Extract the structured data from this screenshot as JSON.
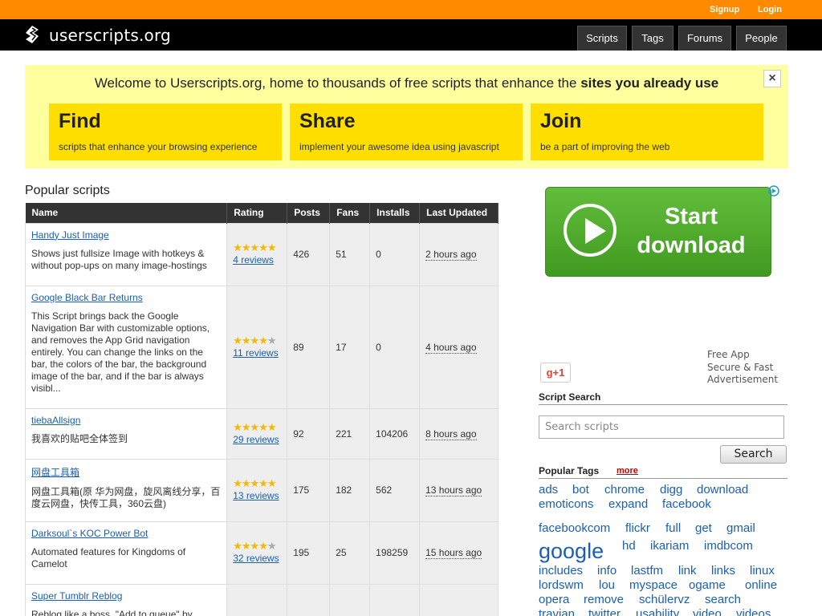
{
  "topbar": {
    "signup": "Signup",
    "login": "Login"
  },
  "header": {
    "logo": "userscripts.org",
    "nav": [
      "Scripts",
      "Tags",
      "Forums",
      "People"
    ]
  },
  "welcome": {
    "text_start": "Welcome to Userscripts.org, home to thousands of free scripts that enhance the ",
    "text_bold": "sites you already use",
    "close": "×",
    "ctas": [
      {
        "title": "Find",
        "subtitle": "scripts that enhance your browsing experience"
      },
      {
        "title": "Share",
        "subtitle": "implement your awesome idea using javascript"
      },
      {
        "title": "Join",
        "subtitle": "be a part of improving the web"
      }
    ]
  },
  "popular": {
    "title": "Popular scripts",
    "columns": [
      "Name",
      "Rating",
      "Posts",
      "Fans",
      "Installs",
      "Last Updated"
    ],
    "rows": [
      {
        "name": "Handy Just Image",
        "desc": "Shows just fullsize Image with hotkeys & without pop-ups on many image-hostings",
        "stars": 5,
        "reviews": "4 reviews",
        "posts": "426",
        "fans": "51",
        "installs": "0",
        "updated": "2 hours ago"
      },
      {
        "name": "Google Black Bar Returns",
        "desc": "This Script brings back the Google Navigation Bar with customizable options, and removes the App Grid navigation entirely. You can change the links on the bar, the colors of the bar, the background image of the bar, and if the bar is always visibl...",
        "stars": 4,
        "reviews": "11 reviews",
        "posts": "89",
        "fans": "17",
        "installs": "0",
        "updated": "4 hours ago"
      },
      {
        "name": "tiebaAllsign",
        "desc": "我喜欢的贴吧全体签到",
        "stars": 5,
        "reviews": "29 reviews",
        "posts": "92",
        "fans": "221",
        "installs": "104206",
        "updated": "8 hours ago"
      },
      {
        "name": "网盘工具箱",
        "desc": "网盘工具箱(原 华为网盘，旋风离线分享，百度云网盘，快传工具，360云盘)",
        "stars": 5,
        "reviews": "13 reviews",
        "posts": "175",
        "fans": "182",
        "installs": "562",
        "updated": "13 hours ago"
      },
      {
        "name": "Darksoul`s KOC Power Bot",
        "desc": "Automated features for Kingdoms of Camelot",
        "stars": 4,
        "reviews": "32 reviews",
        "posts": "195",
        "fans": "25",
        "installs": "198259",
        "updated": "15 hours ago"
      },
      {
        "name": "Super Tumblr Reblog",
        "desc": "Reblog like a boss. \"Add to queue\" by",
        "stars": 0,
        "reviews": "",
        "posts": "",
        "fans": "",
        "installs": "",
        "updated": ""
      }
    ]
  },
  "ad": {
    "banner_line1": "Start",
    "banner_line2": "download",
    "side_lines": [
      "Free App",
      "Secure & Fast",
      "Advertisement"
    ],
    "gplus": "g+1"
  },
  "sidebar": {
    "search_title": "Script Search",
    "search_placeholder": "Search scripts",
    "search_button": "Search",
    "tags_title": "Popular Tags",
    "tags_more": "more",
    "tags": [
      {
        "label": "ads",
        "size": 15
      },
      {
        "label": "bot",
        "size": 15
      },
      {
        "label": "chrome",
        "size": 15
      },
      {
        "label": "digg",
        "size": 15
      },
      {
        "label": "download",
        "size": 15
      },
      {
        "label": "emoticons",
        "size": 15
      },
      {
        "label": "expand",
        "size": 15
      },
      {
        "label": "facebook",
        "size": 15
      },
      {
        "label": "facebookcom",
        "size": 15
      },
      {
        "label": "flickr",
        "size": 15
      },
      {
        "label": "full",
        "size": 15
      },
      {
        "label": "get",
        "size": 15
      },
      {
        "label": "gmail",
        "size": 15
      },
      {
        "label": "google",
        "size": 27
      },
      {
        "label": "hd",
        "size": 15
      },
      {
        "label": "ikariam",
        "size": 15
      },
      {
        "label": "imdbcom",
        "size": 15
      },
      {
        "label": "includes",
        "size": 15
      },
      {
        "label": "info",
        "size": 15
      },
      {
        "label": "lastfm",
        "size": 15
      },
      {
        "label": "link",
        "size": 15
      },
      {
        "label": "links",
        "size": 15
      },
      {
        "label": "linux",
        "size": 15
      },
      {
        "label": "lordswm",
        "size": 15
      },
      {
        "label": "lou",
        "size": 15
      },
      {
        "label": "myspace",
        "size": 15
      },
      {
        "label": "ogame",
        "size": 15
      },
      {
        "label": "online",
        "size": 15
      },
      {
        "label": "opera",
        "size": 15
      },
      {
        "label": "remove",
        "size": 15
      },
      {
        "label": "schülervz",
        "size": 15
      },
      {
        "label": "search",
        "size": 15
      },
      {
        "label": "travian",
        "size": 15
      },
      {
        "label": "twitter",
        "size": 15
      },
      {
        "label": "usability",
        "size": 15
      },
      {
        "label": "video",
        "size": 15
      },
      {
        "label": "videos",
        "size": 15
      }
    ]
  }
}
